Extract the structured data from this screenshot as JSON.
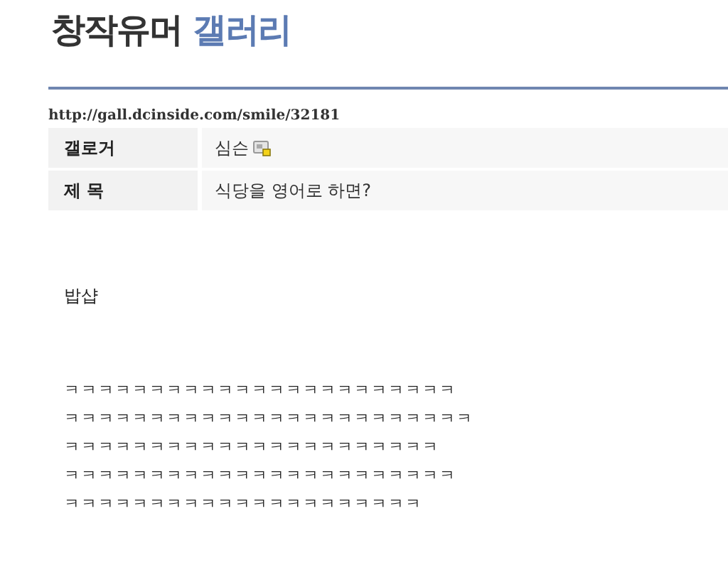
{
  "header": {
    "title": "창작유머",
    "title_accent": "갤러리"
  },
  "url": "http://gall.dcinside.com/smile/32181",
  "info_rows": [
    {
      "label": "갤로거",
      "value": "심슨",
      "kind": "author"
    },
    {
      "label": "제 목",
      "value": "식당을 영어로 하면?",
      "kind": "text"
    }
  ],
  "body": {
    "paragraphs": [
      "밥샵"
    ],
    "lines": [
      "ㅋㅋㅋㅋㅋㅋㅋㅋㅋㅋㅋㅋㅋㅋㅋㅋㅋㅋㅋㅋㅋㅋㅋ",
      "ㅋㅋㅋㅋㅋㅋㅋㅋㅋㅋㅋㅋㅋㅋㅋㅋㅋㅋㅋㅋㅋㅋㅋㅋ",
      "ㅋㅋㅋㅋㅋㅋㅋㅋㅋㅋㅋㅋㅋㅋㅋㅋㅋㅋㅋㅋㅋㅋ",
      "ㅋㅋㅋㅋㅋㅋㅋㅋㅋㅋㅋㅋㅋㅋㅋㅋㅋㅋㅋㅋㅋㅋㅋ",
      "ㅋㅋㅋㅋㅋㅋㅋㅋㅋㅋㅋㅋㅋㅋㅋㅋㅋㅋㅋㅋㅋ"
    ]
  }
}
